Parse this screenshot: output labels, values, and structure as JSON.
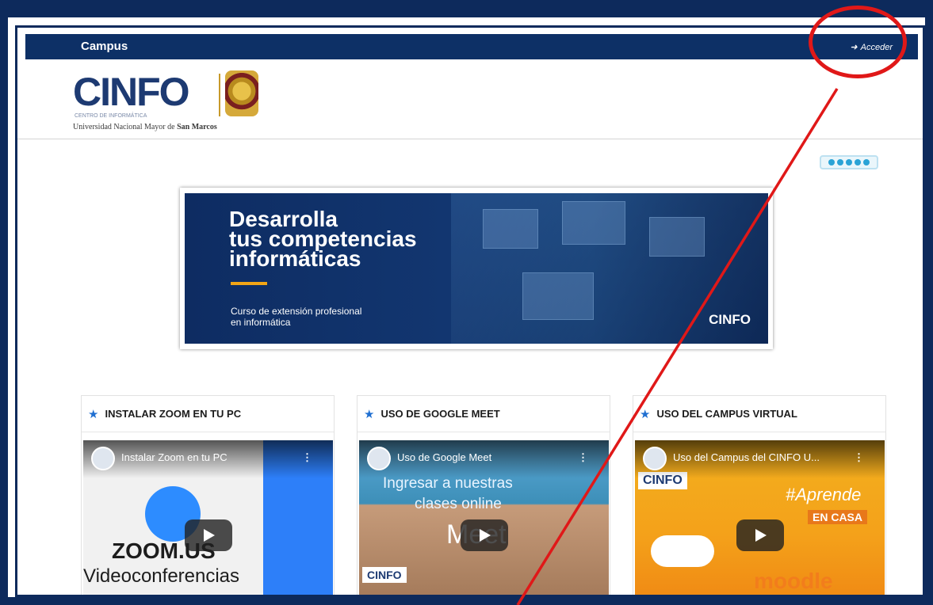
{
  "navbar": {
    "brand": "Campus",
    "login_label": "Acceder",
    "login_icon": "login-icon"
  },
  "logo": {
    "name": "CINFO",
    "subtitle": "CENTRO DE INFORMÁTICA",
    "university_regular": "Universidad Nacional Mayor de",
    "university_bold": "San Marcos"
  },
  "banner": {
    "title_lines": [
      "Desarrolla",
      "tus competencias",
      "informáticas"
    ],
    "subtitle_lines": [
      "Curso de extensión profesional",
      "en informática"
    ],
    "logo_text": "CINFO"
  },
  "carousel": {
    "dots": 5
  },
  "cards": [
    {
      "title": "INSTALAR ZOOM EN TU PC",
      "video_title": "Instalar Zoom en tu PC",
      "video_caption_1": "ZOOM.US",
      "video_caption_2": "Videoconferencias"
    },
    {
      "title": "USO DE GOOGLE MEET",
      "video_title": "Uso de Google Meet",
      "video_caption_1": "Ingresar a nuestras",
      "video_caption_2": "clases online",
      "video_caption_3": "Meet",
      "video_logo": "CINFO"
    },
    {
      "title": "USO DEL CAMPUS VIRTUAL",
      "video_title": "Uso del Campus del CINFO U...",
      "video_caption_1": "#Aprende",
      "video_caption_2": "EN CASA",
      "video_caption_3": "moodle",
      "video_logo": "CINFO"
    }
  ],
  "colors": {
    "navy": "#0d3066",
    "accent_blue": "#1f6fd1",
    "annotation_red": "#e01818",
    "banner_bar": "#f2a516"
  }
}
